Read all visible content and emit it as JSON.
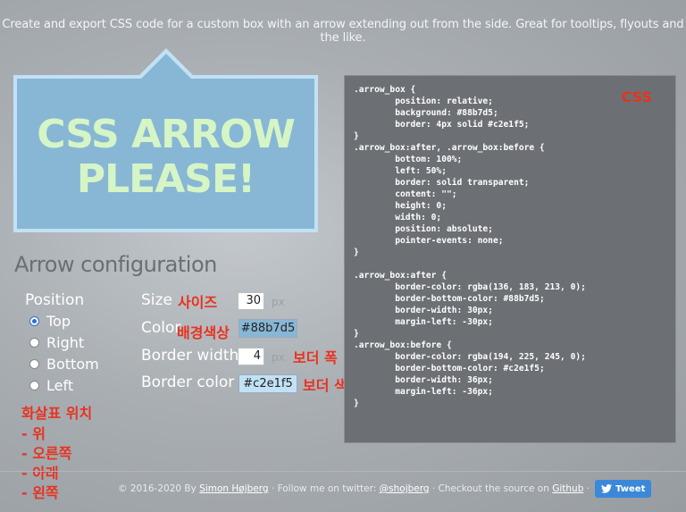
{
  "header": {
    "tagline": "Create and export CSS code for a custom box with an arrow extending out from the side. Great for tooltips, flyouts and the like."
  },
  "preview": {
    "line1": "CSS ARROW",
    "line2": "PLEASE!",
    "background": "#88b7d5",
    "border": "#c2e1f5",
    "text_color": "#d6f5c6"
  },
  "config": {
    "title": "Arrow configuration",
    "position_label": "Position",
    "positions": [
      "Top",
      "Right",
      "Bottom",
      "Left"
    ],
    "selected_position": "Top",
    "size_label": "Size",
    "size_value": "30",
    "size_unit": "px",
    "color_label": "Color",
    "color_value": "#88b7d5",
    "border_width_label": "Border width",
    "border_width_value": "4",
    "border_width_unit": "px",
    "border_color_label": "Border color",
    "border_color_value": "#c2e1f5"
  },
  "annotations": {
    "size": "사이즈",
    "color": "배경색상",
    "border_width": "보더 폭",
    "border_color": "보더 색상",
    "css": "CSS",
    "position_title": "화살표 위치",
    "position_items": [
      "- 위",
      "- 오른쪽",
      "- 아래",
      "- 왼쪽"
    ]
  },
  "code": {
    "text": ".arrow_box {\n\tposition: relative;\n\tbackground: #88b7d5;\n\tborder: 4px solid #c2e1f5;\n}\n.arrow_box:after, .arrow_box:before {\n\tbottom: 100%;\n\tleft: 50%;\n\tborder: solid transparent;\n\tcontent: \"\";\n\theight: 0;\n\twidth: 0;\n\tposition: absolute;\n\tpointer-events: none;\n}\n\n.arrow_box:after {\n\tborder-color: rgba(136, 183, 213, 0);\n\tborder-bottom-color: #88b7d5;\n\tborder-width: 30px;\n\tmargin-left: -30px;\n}\n.arrow_box:before {\n\tborder-color: rgba(194, 225, 245, 0);\n\tborder-bottom-color: #c2e1f5;\n\tborder-width: 36px;\n\tmargin-left: -36px;\n}"
  },
  "footer": {
    "copyright": "© 2016-2020 By",
    "author": "Simon Højberg",
    "follow": "· Follow me on twitter:",
    "twitter": "@shojberg",
    "source": "· Checkout the source on",
    "github": "Github",
    "sep": "·",
    "tweet": "Tweet"
  }
}
